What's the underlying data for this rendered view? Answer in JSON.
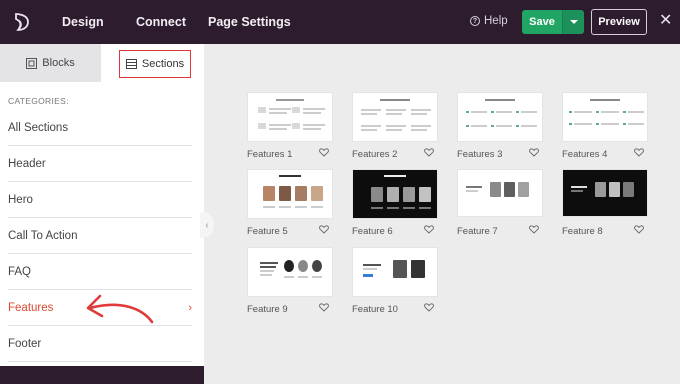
{
  "topbar": {
    "nav": [
      "Design",
      "Connect",
      "Page Settings"
    ],
    "help_label": "Help",
    "save_label": "Save",
    "preview_label": "Preview"
  },
  "sidebar": {
    "tabs": {
      "blocks": "Blocks",
      "sections": "Sections"
    },
    "categories_label": "CATEGORIES:",
    "categories": [
      "All Sections",
      "Header",
      "Hero",
      "Call To Action",
      "FAQ",
      "Features",
      "Footer"
    ],
    "active_category": "Features"
  },
  "cards": [
    {
      "title": "Features 1"
    },
    {
      "title": "Features 2"
    },
    {
      "title": "Features 3"
    },
    {
      "title": "Features 4"
    },
    {
      "title": "Feature 5"
    },
    {
      "title": "Feature 6"
    },
    {
      "title": "Feature 7"
    },
    {
      "title": "Feature 8"
    },
    {
      "title": "Feature 9"
    },
    {
      "title": "Feature 10"
    }
  ],
  "colors": {
    "topbar_bg": "#2d1b2e",
    "save_green": "#21a565",
    "accent_red": "#dc4a2e",
    "annotation_red": "#e03a3a"
  }
}
